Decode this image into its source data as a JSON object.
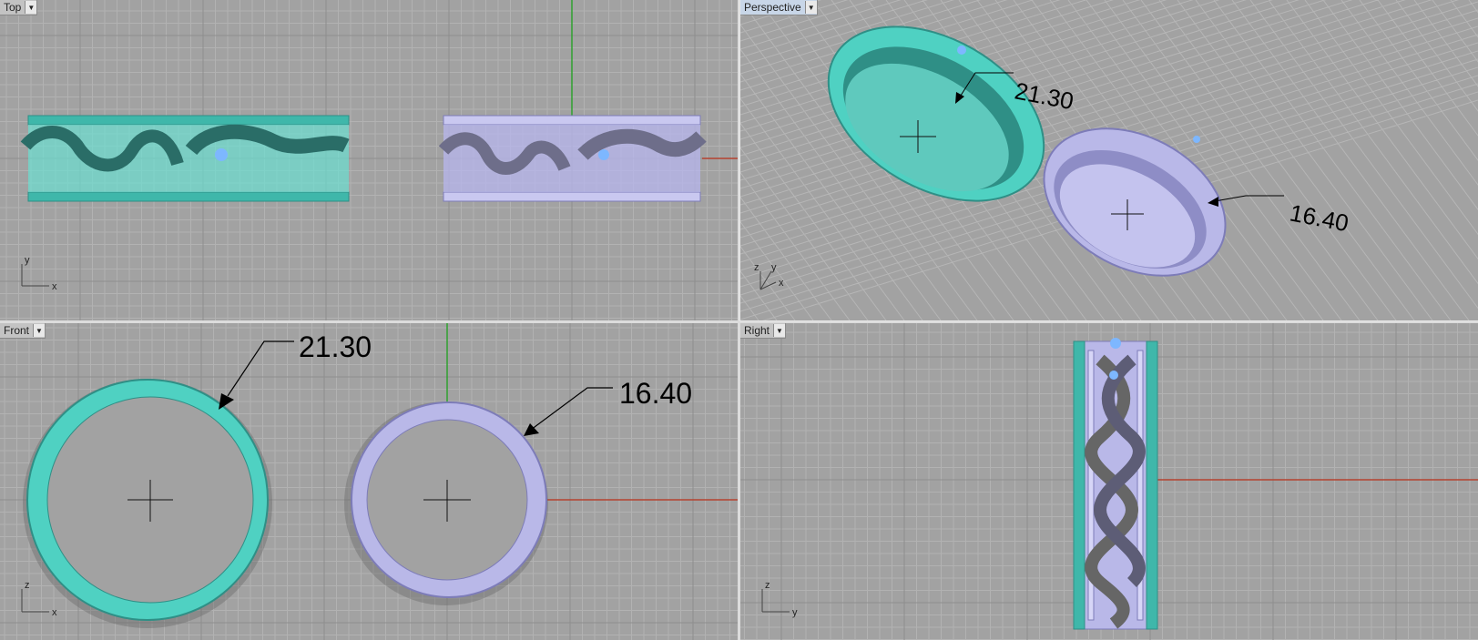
{
  "viewports": {
    "top": {
      "label": "Top",
      "axis_x": "x",
      "axis_y": "y"
    },
    "perspective": {
      "label": "Perspective",
      "axis_x": "x",
      "axis_y": "y",
      "axis_z": "z"
    },
    "front": {
      "label": "Front",
      "axis_x": "x",
      "axis_z": "z"
    },
    "right": {
      "label": "Right",
      "axis_y": "y",
      "axis_z": "z"
    }
  },
  "dimensions": {
    "large_ring": "21.30",
    "small_ring": "16.40"
  },
  "colors": {
    "viewport_bg": "#a2a2a2",
    "grid_minor": "#b2b2b2",
    "grid_major": "#8e8e8e",
    "ring_teal": "#4fd1c2",
    "ring_teal_dark": "#2f8f86",
    "ring_lavender": "#b9b8e8",
    "ring_lavender_dark": "#7d7cb8",
    "axis_red": "#b4432f",
    "axis_green": "#2fa12f",
    "gem_blue": "#7db7ff"
  },
  "icons": {
    "dropdown": "triangle-down-icon"
  }
}
